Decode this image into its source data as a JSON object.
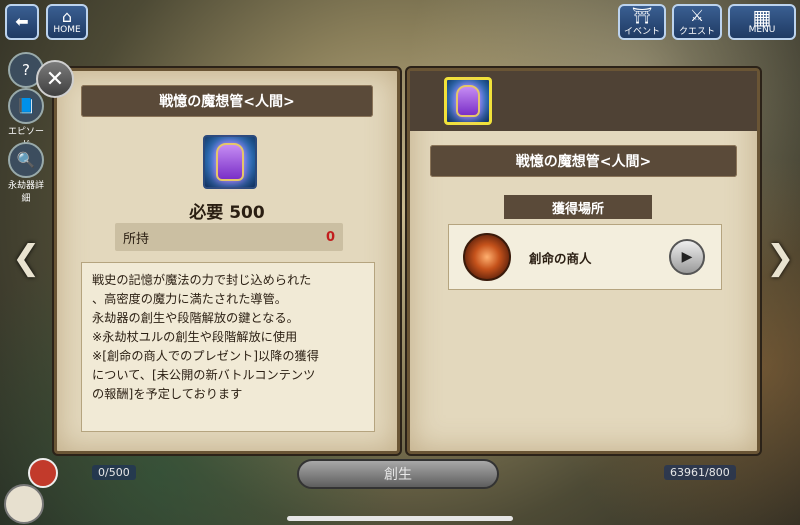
{
  "top_bar": {
    "home_label": "HOME",
    "event_label": "イベント",
    "quest_label": "クエスト",
    "menu_label": "MENU"
  },
  "side": {
    "episode_label": "エピソード",
    "weapon_detail_label": "永劫器詳細"
  },
  "left_panel": {
    "title": "戦憶の魔想管<人間>",
    "required_label": "必要",
    "required_value": "500",
    "owned_label": "所持",
    "owned_value": "0",
    "description": "戦史の記憶が魔法の力で封じ込められた\n、高密度の魔力に満たされた導管。\n永劫器の創生や段階解放の鍵となる。\n※永劫杖ユルの創生や段階解放に使用\n※[創命の商人でのプレゼント]以降の獲得\nについて、[未公開の新バトルコンテンツ\nの報酬]を予定しております"
  },
  "right_panel": {
    "title": "戦憶の魔想管<人間>",
    "source_header": "獲得場所",
    "source_item": "創命の商人"
  },
  "bottom": {
    "action_label": "創生",
    "count_left": "0/500",
    "count_right": "63961/800"
  },
  "colors": {
    "panel_bg": "#e3d8bd",
    "title_bar": "#5a4a39",
    "owned_value": "#c21d1d",
    "selection_border": "#f1e23a"
  }
}
